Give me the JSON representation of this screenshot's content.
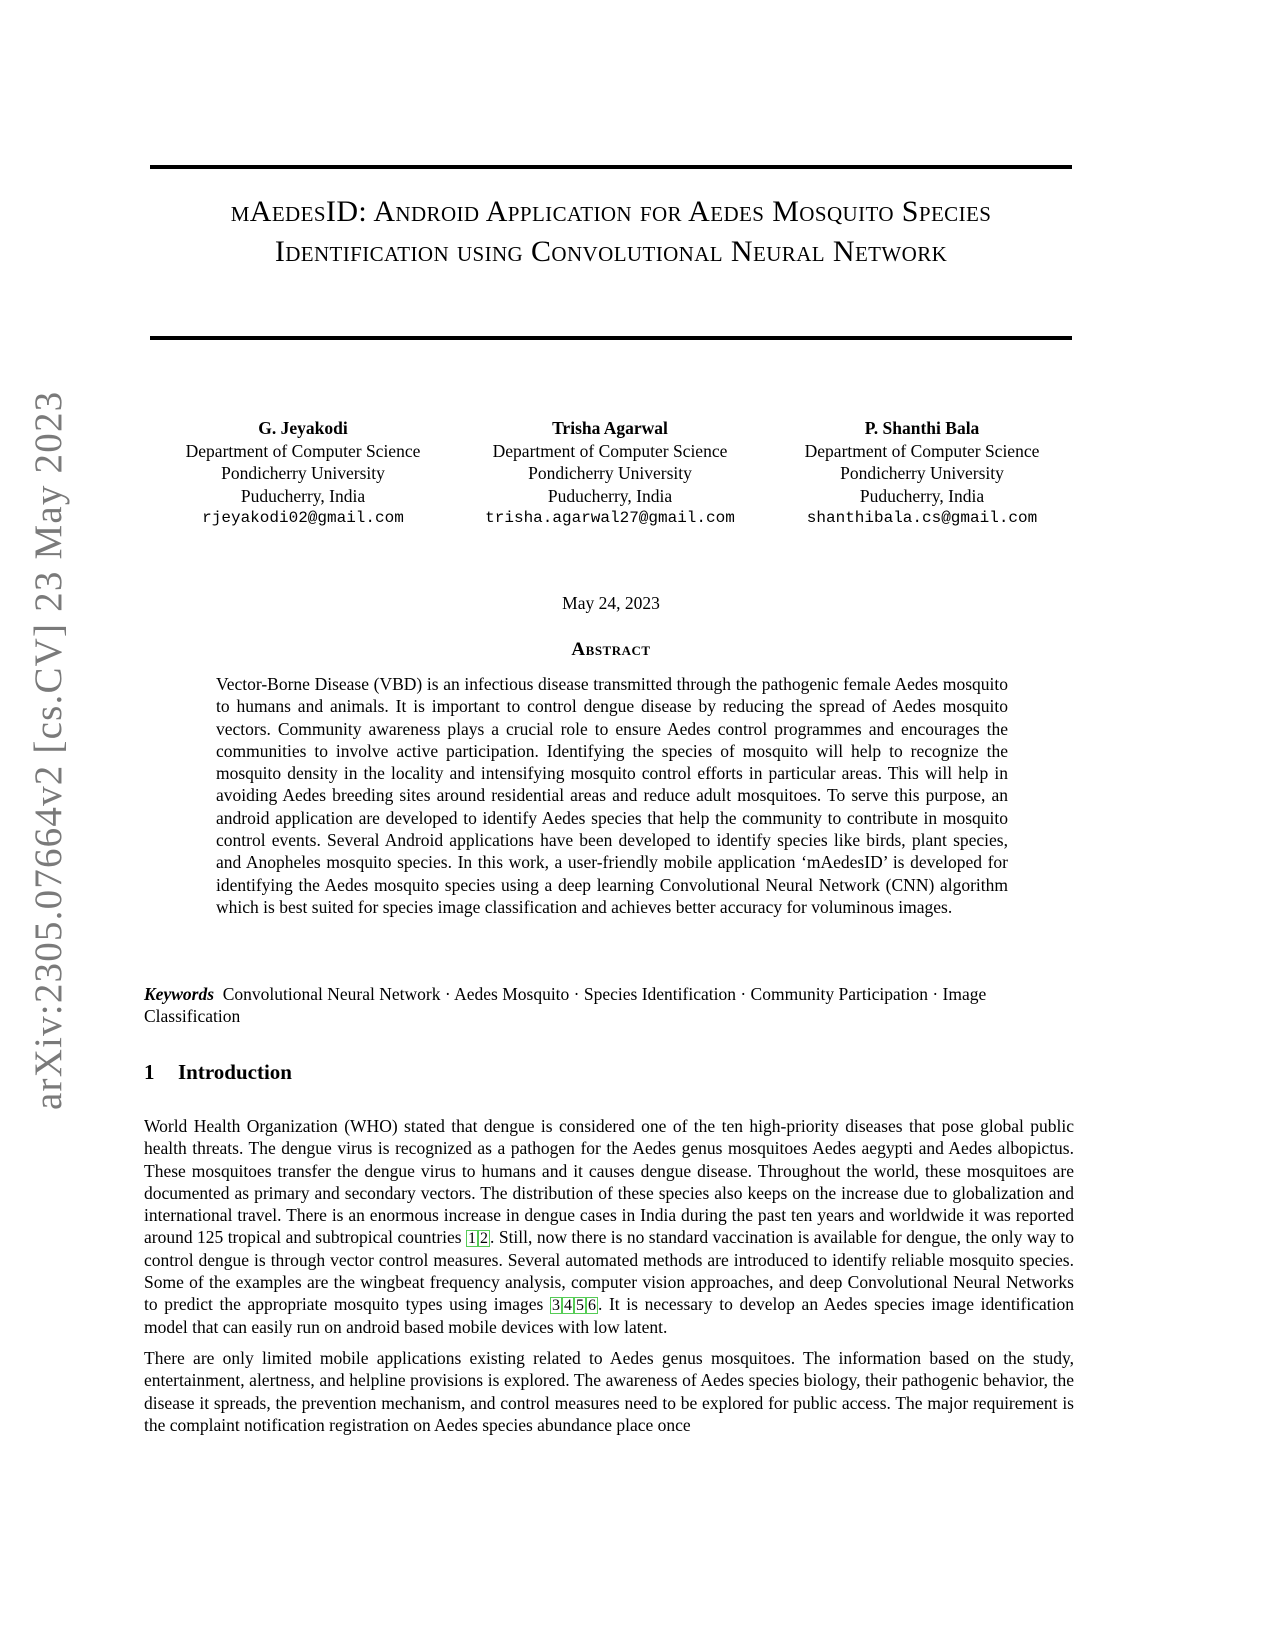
{
  "side_stamp": "arXiv:2305.07664v2  [cs.CV]  23 May 2023",
  "title": "mAedesID: Android Application for Aedes Mosquito Species Identification using Convolutional Neural Network",
  "authors": [
    {
      "name": "G. Jeyakodi",
      "department": "Department of Computer Science",
      "university": "Pondicherry University",
      "location": "Puducherry, India",
      "email": "rjeyakodi02@gmail.com"
    },
    {
      "name": "Trisha Agarwal",
      "department": "Department of Computer Science",
      "university": "Pondicherry University",
      "location": "Puducherry, India",
      "email": "trisha.agarwal27@gmail.com"
    },
    {
      "name": "P. Shanthi Bala",
      "department": "Department of Computer Science",
      "university": "Pondicherry University",
      "location": "Puducherry, India",
      "email": "shanthibala.cs@gmail.com"
    }
  ],
  "date": "May 24, 2023",
  "abstract": {
    "heading": "Abstract",
    "text": "Vector-Borne Disease (VBD) is an infectious disease transmitted through the pathogenic female Aedes mosquito to humans and animals. It is important to control dengue disease by reducing the spread of Aedes mosquito vectors. Community awareness plays a crucial role to ensure Aedes control programmes and encourages the communities to involve active participation. Identifying the species of mosquito will help to recognize the mosquito density in the locality and intensifying mosquito control efforts in particular areas. This will help in avoiding Aedes breeding sites around residential areas and reduce adult mosquitoes. To serve this purpose, an android application are developed to identify Aedes species that help the community to contribute in mosquito control events. Several Android applications have been developed to identify species like birds, plant species, and Anopheles mosquito species. In this work, a user-friendly mobile application ‘mAedesID’ is developed for identifying the Aedes mosquito species using a deep learning Convolutional Neural Network (CNN) algorithm which is best suited for species image classification and achieves better accuracy for voluminous images."
  },
  "keywords": {
    "label": "Keywords",
    "text": "Convolutional Neural Network · Aedes Mosquito · Species Identification · Community Participation · Image Classification"
  },
  "section": {
    "number": "1",
    "title": "Introduction",
    "p1_a": "World Health Organization (WHO) stated that dengue is considered one of the ten high-priority diseases that pose global public health threats. The dengue virus is recognized as a pathogen for the Aedes genus mosquitoes Aedes aegypti and Aedes albopictus. These mosquitoes transfer the dengue virus to humans and it causes dengue disease. Throughout the world, these mosquitoes are documented as primary and secondary vectors. The distribution of these species also keeps on the increase due to globalization and international travel. There is an enormous increase in dengue cases in India during the past ten years and worldwide it was reported around 125 tropical and subtropical countries ",
    "cites_1": [
      "1",
      "2"
    ],
    "p1_b": ". Still, now there is no standard vaccination is available for dengue, the only way to control dengue is through vector control measures. Several automated methods are introduced to identify reliable mosquito species. Some of the examples are the wingbeat frequency analysis, computer vision approaches, and deep Convolutional Neural Networks to predict the appropriate mosquito types using images ",
    "cites_2": [
      "3",
      "4",
      "5",
      "6"
    ],
    "p1_c": ". It is necessary to develop an Aedes species image identification model that can easily run on android based mobile devices with low latent.",
    "p2": "There are only limited mobile applications existing related to Aedes genus mosquitoes. The information based on the study, entertainment, alertness, and helpline provisions is explored. The awareness of Aedes species biology, their pathogenic behavior, the disease it spreads, the prevention mechanism, and control measures need to be explored for public access. The major requirement is the complaint notification registration on Aedes species abundance place once"
  }
}
